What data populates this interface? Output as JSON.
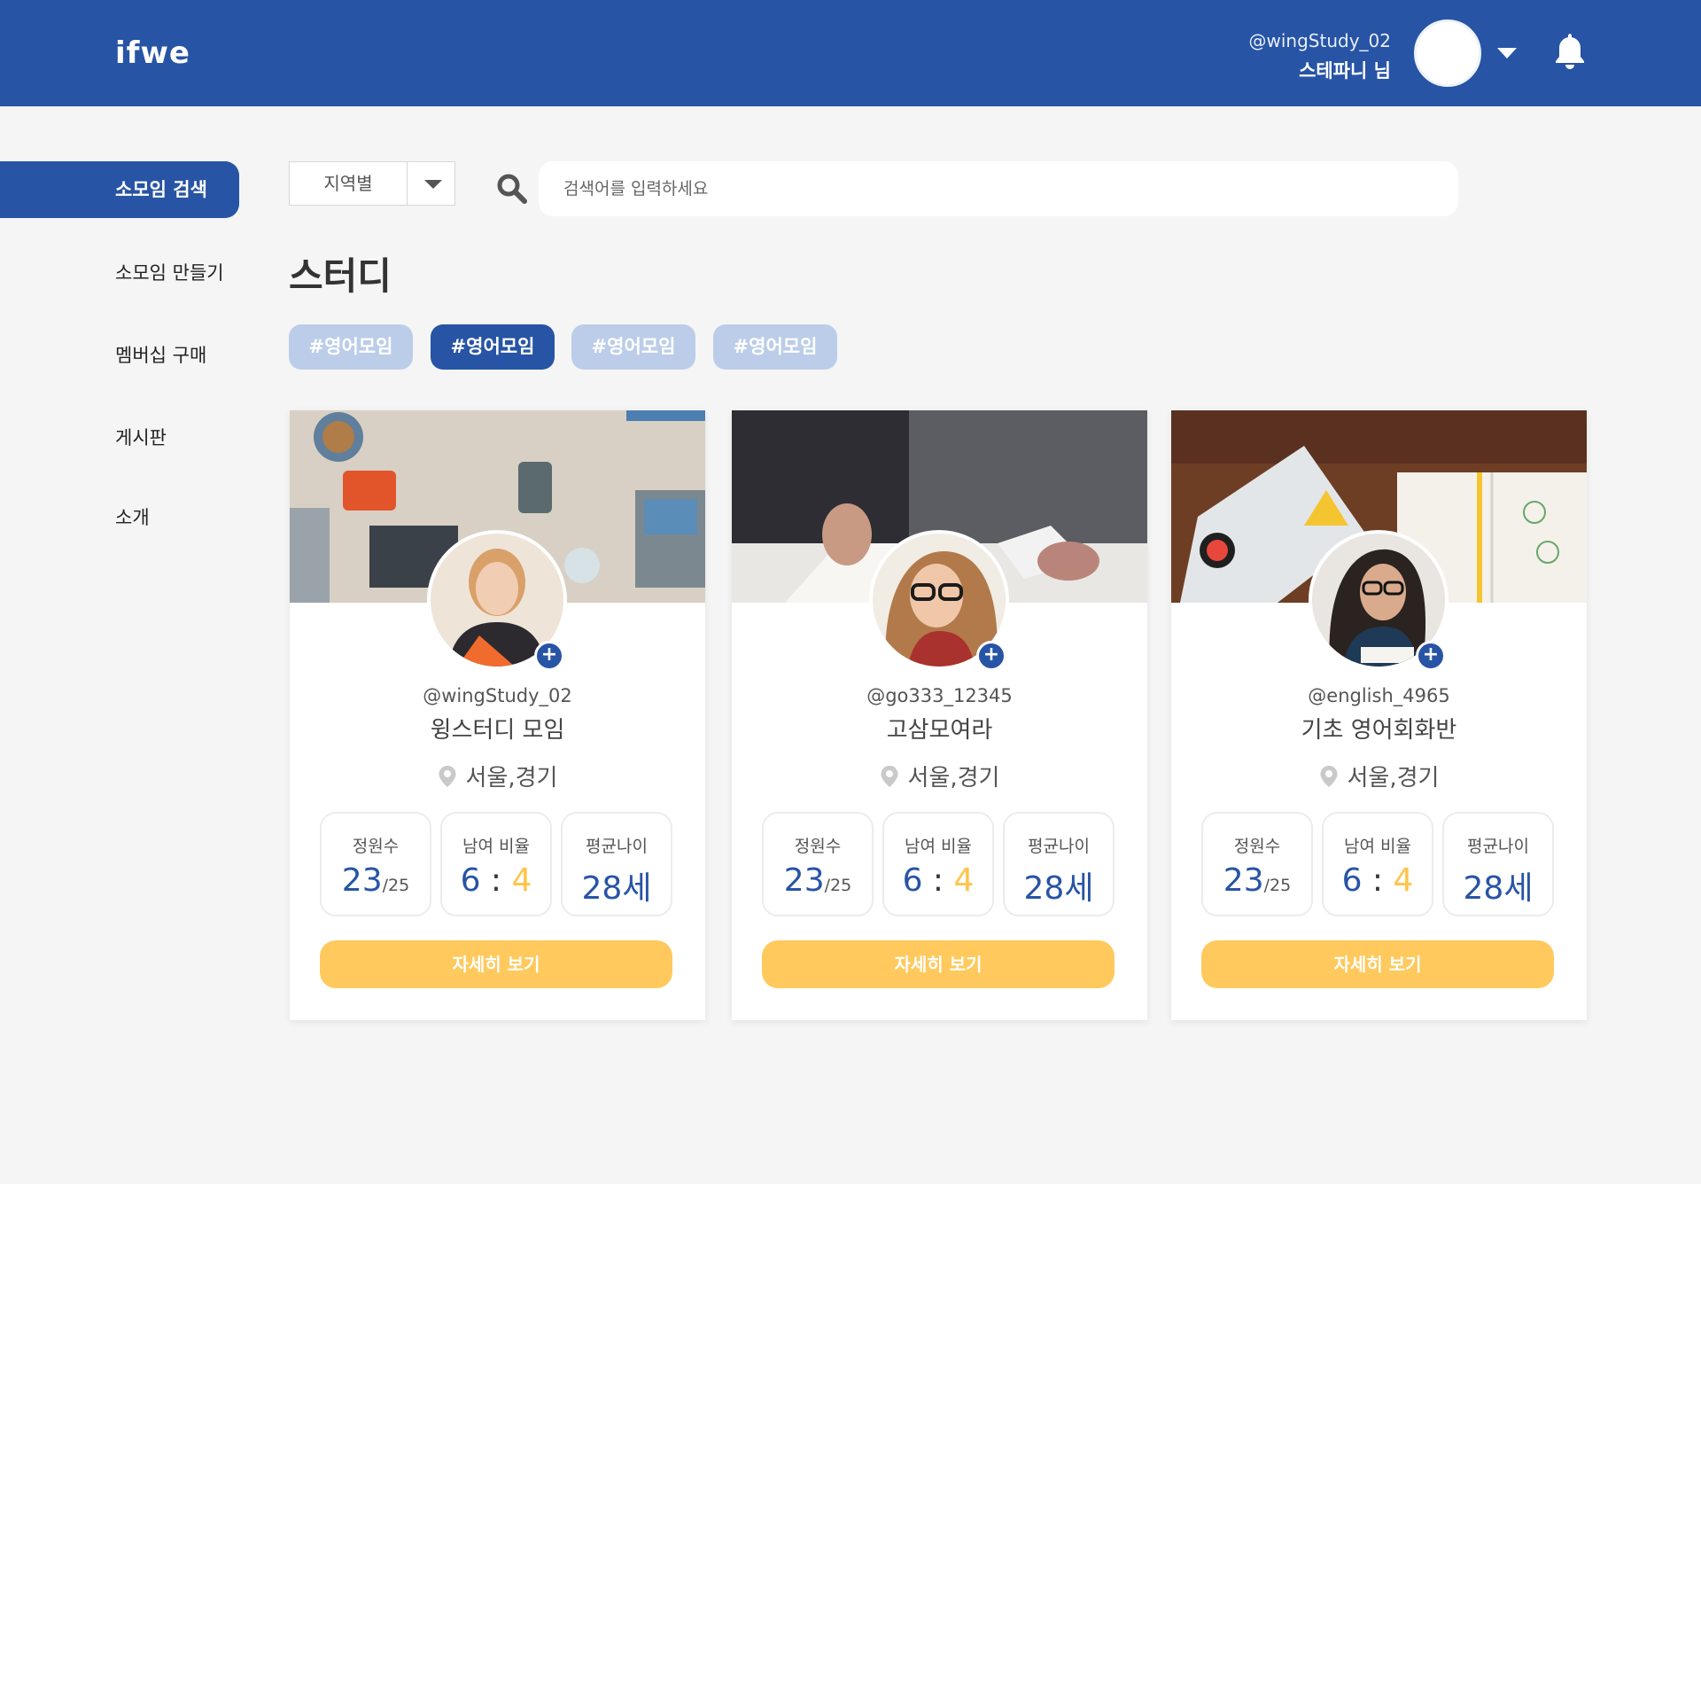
{
  "header": {
    "logo": "ifwe",
    "user_id": "@wingStudy_02",
    "user_name": "스테파니 님",
    "icons": [
      "avatar",
      "chevron-down-icon",
      "bell-icon"
    ]
  },
  "sidebar": {
    "items": [
      {
        "label": "소모임 검색",
        "active": true
      },
      {
        "label": "소모임 만들기",
        "active": false
      },
      {
        "label": "멤버십 구매",
        "active": false
      },
      {
        "label": "게시판",
        "active": false
      },
      {
        "label": "소개",
        "active": false
      }
    ]
  },
  "search": {
    "region_label": "지역별",
    "placeholder": "검색어를 입력하세요"
  },
  "page_title": "스터디",
  "tags": [
    {
      "label": "#영어모임",
      "active": false
    },
    {
      "label": "#영어모임",
      "active": true
    },
    {
      "label": "#영어모임",
      "active": false
    },
    {
      "label": "#영어모임",
      "active": false
    }
  ],
  "stat_labels": {
    "members": "정원수",
    "ratio": "남여 비율",
    "age": "평균나이"
  },
  "cards": [
    {
      "handle": "@wingStudy_02",
      "name": "윙스터디 모임",
      "location": "서울,경기",
      "members": "23",
      "capacity": "/25",
      "ratio_male": "6",
      "ratio_sep": ":",
      "ratio_female": "4",
      "avg_age": "28세",
      "button": "자세히 보기"
    },
    {
      "handle": "@go333_12345",
      "name": "고삼모여라",
      "location": "서울,경기",
      "members": "23",
      "capacity": "/25",
      "ratio_male": "6",
      "ratio_sep": ":",
      "ratio_female": "4",
      "avg_age": "28세",
      "button": "자세히 보기"
    },
    {
      "handle": "@english_4965",
      "name": "기초 영어회화반",
      "location": "서울,경기",
      "members": "23",
      "capacity": "/25",
      "ratio_male": "6",
      "ratio_sep": ":",
      "ratio_female": "4",
      "avg_age": "28세",
      "button": "자세히 보기"
    }
  ],
  "colors": {
    "primary": "#2754a5",
    "tag_inactive": "#bccde9",
    "accent_yellow": "#ffc95d",
    "background": "#f5f5f5"
  }
}
